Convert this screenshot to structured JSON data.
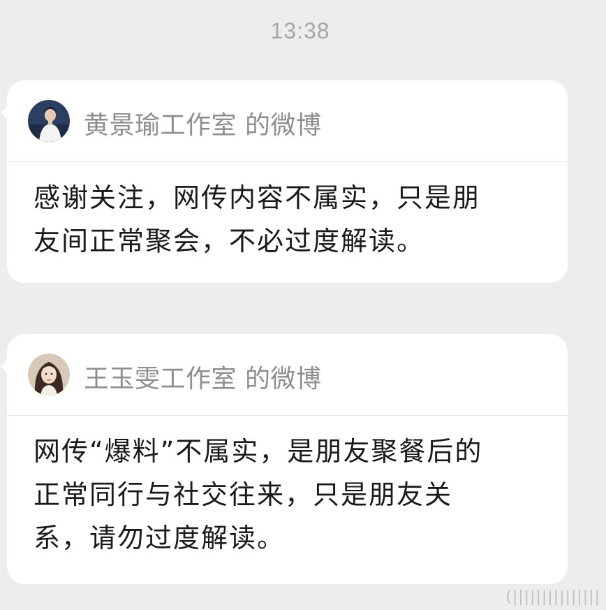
{
  "status": {
    "time": "13:38"
  },
  "messages": [
    {
      "source_name": "黄景瑜工作室 的微博",
      "avatar_icon": "avatar-man-white-shirt",
      "lines": [
        "感谢关注，网传内容不属实，只是朋",
        "友间正常聚会，不必过度解读。"
      ]
    },
    {
      "source_name": "王玉雯工作室 的微博",
      "avatar_icon": "avatar-woman-dark-hair",
      "lines": [
        "网传“爆料”不属实，是朋友聚餐后的",
        "正常同行与社交往来，只是朋友关",
        "系，请勿过度解读。"
      ]
    }
  ],
  "watermark": "(|||||||||||||||"
}
